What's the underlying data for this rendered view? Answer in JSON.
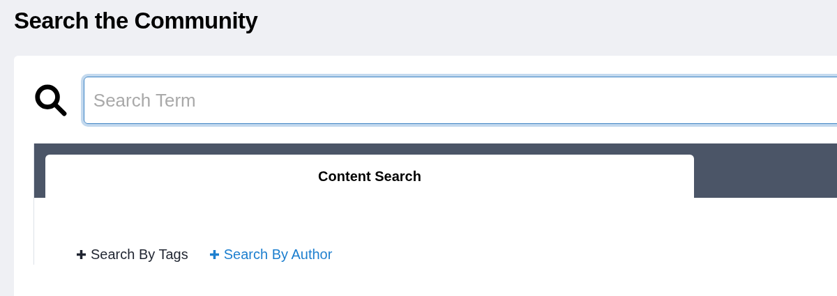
{
  "page_title": "Search the Community",
  "search": {
    "placeholder": "Search Term"
  },
  "tabs": [
    {
      "label": "Content Search",
      "selected": true
    }
  ],
  "filter_links": [
    {
      "label": "Search By Tags",
      "selected": true
    },
    {
      "label": "Search By Author",
      "selected": false
    }
  ]
}
